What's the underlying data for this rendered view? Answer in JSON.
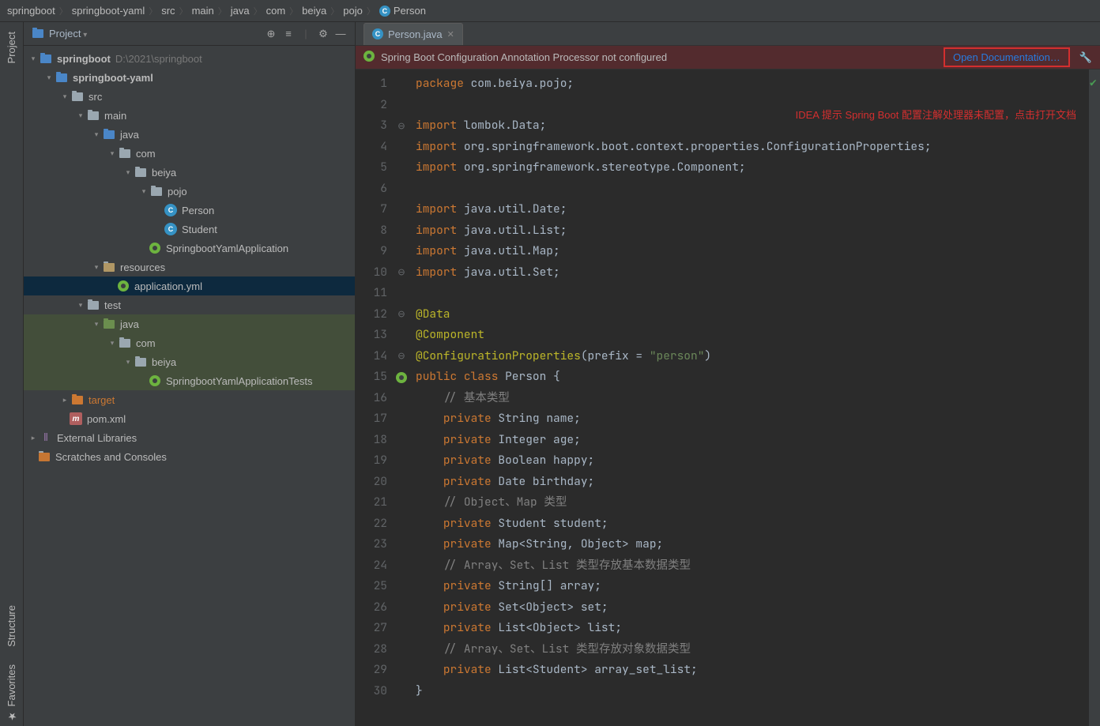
{
  "breadcrumb": [
    "springboot",
    "springboot-yaml",
    "src",
    "main",
    "java",
    "com",
    "beiya",
    "pojo",
    "Person"
  ],
  "panel": {
    "title": "Project"
  },
  "sidebar": {
    "left": [
      "Project",
      "Structure",
      "Favorites"
    ]
  },
  "tree": {
    "root": {
      "label": "springboot",
      "hint": "D:\\2021\\springboot"
    },
    "yaml": {
      "label": "springboot-yaml"
    },
    "src": {
      "label": "src"
    },
    "main": {
      "label": "main"
    },
    "java": {
      "label": "java"
    },
    "com": {
      "label": "com"
    },
    "beiya": {
      "label": "beiya"
    },
    "pojo": {
      "label": "pojo"
    },
    "person": {
      "label": "Person"
    },
    "student": {
      "label": "Student"
    },
    "sbapp": {
      "label": "SpringbootYamlApplication"
    },
    "resources": {
      "label": "resources"
    },
    "appyml": {
      "label": "application.yml"
    },
    "test": {
      "label": "test"
    },
    "tjava": {
      "label": "java"
    },
    "tcom": {
      "label": "com"
    },
    "tbeiya": {
      "label": "beiya"
    },
    "sbapptests": {
      "label": "SpringbootYamlApplicationTests"
    },
    "target": {
      "label": "target"
    },
    "pom": {
      "label": "pom.xml"
    },
    "extlib": {
      "label": "External Libraries"
    },
    "scratch": {
      "label": "Scratches and Consoles"
    }
  },
  "tab": {
    "label": "Person.java"
  },
  "banner": {
    "msg": "Spring Boot Configuration Annotation Processor not configured",
    "link": "Open Documentation…"
  },
  "annotation": "IDEA 提示 Spring Boot 配置注解处理器未配置，点击打开文档",
  "code_lines": [
    {
      "n": 1,
      "seg": [
        {
          "c": "kw",
          "t": "package "
        },
        {
          "c": "pkgc",
          "t": "com.beiya.pojo"
        },
        {
          "c": "",
          "t": ";"
        }
      ]
    },
    {
      "n": 2,
      "seg": []
    },
    {
      "n": 3,
      "seg": [
        {
          "c": "kw",
          "t": "import "
        },
        {
          "c": "pkgc",
          "t": "lombok.Data"
        },
        {
          "c": "",
          "t": ";"
        }
      ]
    },
    {
      "n": 4,
      "seg": [
        {
          "c": "kw",
          "t": "import "
        },
        {
          "c": "pkgc",
          "t": "org.springframework.boot.context.properties.ConfigurationProperties"
        },
        {
          "c": "",
          "t": ";"
        }
      ]
    },
    {
      "n": 5,
      "seg": [
        {
          "c": "kw",
          "t": "import "
        },
        {
          "c": "pkgc",
          "t": "org.springframework.stereotype.Component"
        },
        {
          "c": "",
          "t": ";"
        }
      ]
    },
    {
      "n": 6,
      "seg": []
    },
    {
      "n": 7,
      "seg": [
        {
          "c": "kw",
          "t": "import "
        },
        {
          "c": "pkgc",
          "t": "java.util.Date"
        },
        {
          "c": "",
          "t": ";"
        }
      ]
    },
    {
      "n": 8,
      "seg": [
        {
          "c": "kw",
          "t": "import "
        },
        {
          "c": "pkgc",
          "t": "java.util.List"
        },
        {
          "c": "",
          "t": ";"
        }
      ]
    },
    {
      "n": 9,
      "seg": [
        {
          "c": "kw",
          "t": "import "
        },
        {
          "c": "pkgc",
          "t": "java.util.Map"
        },
        {
          "c": "",
          "t": ";"
        }
      ]
    },
    {
      "n": 10,
      "seg": [
        {
          "c": "kw",
          "t": "import "
        },
        {
          "c": "pkgc",
          "t": "java.util.Set"
        },
        {
          "c": "",
          "t": ";"
        }
      ]
    },
    {
      "n": 11,
      "seg": []
    },
    {
      "n": 12,
      "seg": [
        {
          "c": "ann",
          "t": "@Data"
        }
      ]
    },
    {
      "n": 13,
      "seg": [
        {
          "c": "ann",
          "t": "@Component"
        }
      ]
    },
    {
      "n": 14,
      "seg": [
        {
          "c": "ann",
          "t": "@ConfigurationProperties"
        },
        {
          "c": "",
          "t": "(prefix = "
        },
        {
          "c": "str",
          "t": "\"person\""
        },
        {
          "c": "",
          "t": ")"
        }
      ]
    },
    {
      "n": 15,
      "seg": [
        {
          "c": "kw",
          "t": "public class "
        },
        {
          "c": "cls",
          "t": "Person "
        },
        {
          "c": "",
          "t": "{"
        }
      ]
    },
    {
      "n": 16,
      "seg": [
        {
          "c": "",
          "t": "    "
        },
        {
          "c": "cmt",
          "t": "// 基本类型"
        }
      ]
    },
    {
      "n": 17,
      "seg": [
        {
          "c": "",
          "t": "    "
        },
        {
          "c": "kw",
          "t": "private "
        },
        {
          "c": "type",
          "t": "String name"
        },
        {
          "c": "",
          "t": ";"
        }
      ]
    },
    {
      "n": 18,
      "seg": [
        {
          "c": "",
          "t": "    "
        },
        {
          "c": "kw",
          "t": "private "
        },
        {
          "c": "type",
          "t": "Integer age"
        },
        {
          "c": "",
          "t": ";"
        }
      ]
    },
    {
      "n": 19,
      "seg": [
        {
          "c": "",
          "t": "    "
        },
        {
          "c": "kw",
          "t": "private "
        },
        {
          "c": "type",
          "t": "Boolean happy"
        },
        {
          "c": "",
          "t": ";"
        }
      ]
    },
    {
      "n": 20,
      "seg": [
        {
          "c": "",
          "t": "    "
        },
        {
          "c": "kw",
          "t": "private "
        },
        {
          "c": "type",
          "t": "Date birthday"
        },
        {
          "c": "",
          "t": ";"
        }
      ]
    },
    {
      "n": 21,
      "seg": [
        {
          "c": "",
          "t": "    "
        },
        {
          "c": "cmt",
          "t": "// Object、Map 类型"
        }
      ]
    },
    {
      "n": 22,
      "seg": [
        {
          "c": "",
          "t": "    "
        },
        {
          "c": "kw",
          "t": "private "
        },
        {
          "c": "type",
          "t": "Student student"
        },
        {
          "c": "",
          "t": ";"
        }
      ]
    },
    {
      "n": 23,
      "seg": [
        {
          "c": "",
          "t": "    "
        },
        {
          "c": "kw",
          "t": "private "
        },
        {
          "c": "type",
          "t": "Map<String, Object> map"
        },
        {
          "c": "",
          "t": ";"
        }
      ]
    },
    {
      "n": 24,
      "seg": [
        {
          "c": "",
          "t": "    "
        },
        {
          "c": "cmt",
          "t": "// Array、Set、List 类型存放基本数据类型"
        }
      ]
    },
    {
      "n": 25,
      "seg": [
        {
          "c": "",
          "t": "    "
        },
        {
          "c": "kw",
          "t": "private "
        },
        {
          "c": "type",
          "t": "String[] array"
        },
        {
          "c": "",
          "t": ";"
        }
      ]
    },
    {
      "n": 26,
      "seg": [
        {
          "c": "",
          "t": "    "
        },
        {
          "c": "kw",
          "t": "private "
        },
        {
          "c": "type",
          "t": "Set<Object> set"
        },
        {
          "c": "",
          "t": ";"
        }
      ]
    },
    {
      "n": 27,
      "seg": [
        {
          "c": "",
          "t": "    "
        },
        {
          "c": "kw",
          "t": "private "
        },
        {
          "c": "type",
          "t": "List<Object> list"
        },
        {
          "c": "",
          "t": ";"
        }
      ]
    },
    {
      "n": 28,
      "seg": [
        {
          "c": "",
          "t": "    "
        },
        {
          "c": "cmt",
          "t": "// Array、Set、List 类型存放对象数据类型"
        }
      ]
    },
    {
      "n": 29,
      "seg": [
        {
          "c": "",
          "t": "    "
        },
        {
          "c": "kw",
          "t": "private "
        },
        {
          "c": "type",
          "t": "List<Student> array_set_list"
        },
        {
          "c": "",
          "t": ";"
        }
      ]
    },
    {
      "n": 30,
      "seg": [
        {
          "c": "",
          "t": "}"
        }
      ]
    }
  ]
}
